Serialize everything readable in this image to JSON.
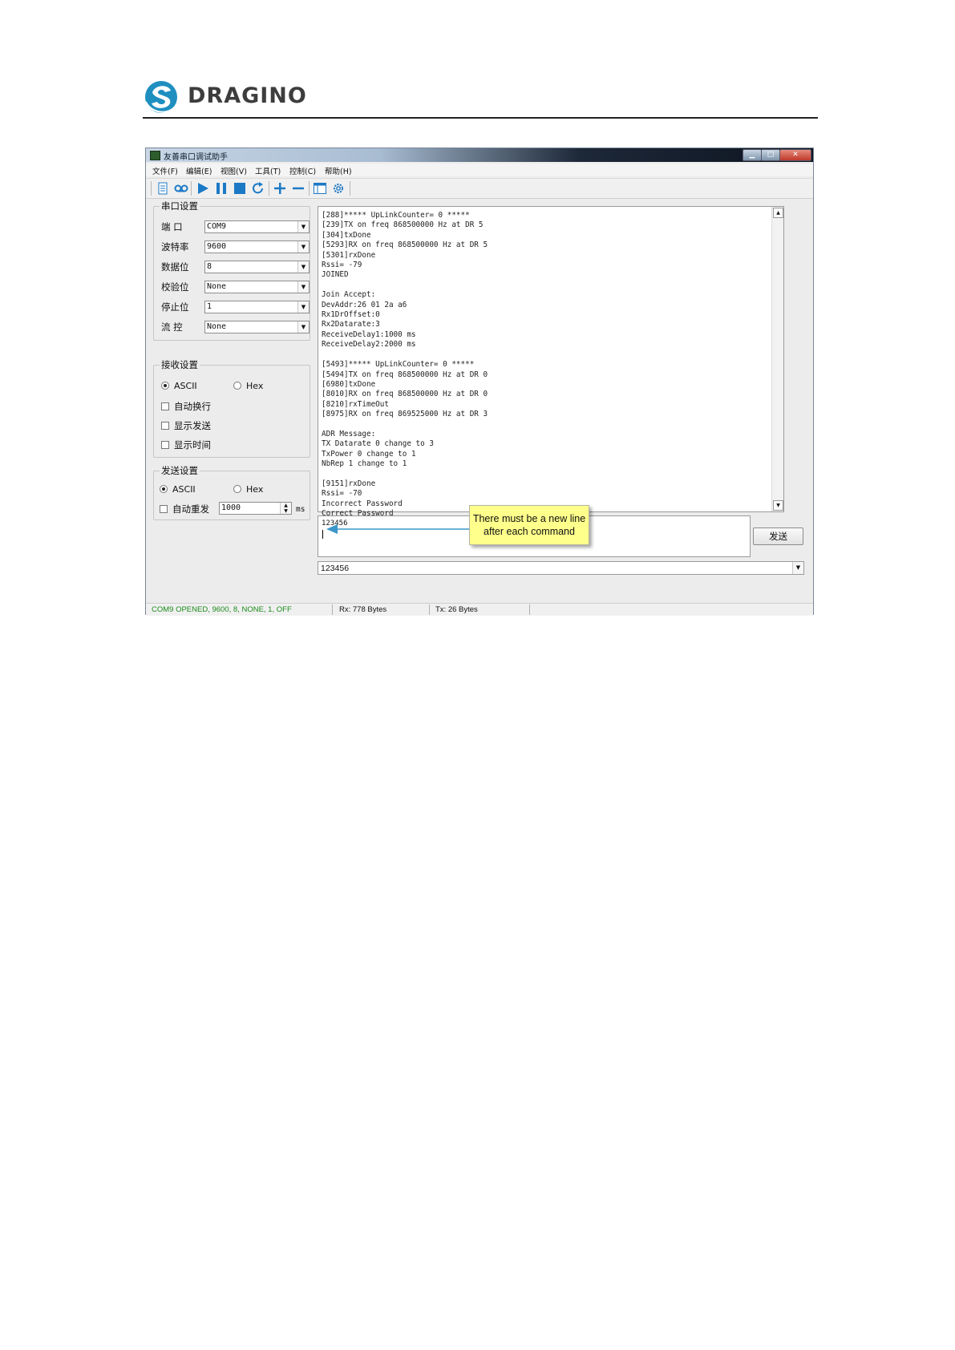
{
  "brand": {
    "name": "DRAGINO",
    "logo_colors": {
      "primary": "#1f8fc0",
      "text": "#3d3d3d"
    }
  },
  "window": {
    "title": "友善串口调试助手",
    "controls": {
      "minimize": "▁",
      "maximize": "□",
      "close": "✕"
    }
  },
  "menu": [
    "文件(F)",
    "编辑(E)",
    "视图(V)",
    "工具(T)",
    "控制(C)",
    "帮助(H)"
  ],
  "toolbar": {
    "icons": [
      "document-icon",
      "record-icon",
      "play-icon",
      "pause-icon",
      "stop-icon",
      "refresh-icon",
      "add-icon",
      "remove-icon",
      "window-icon",
      "settings-icon"
    ],
    "accent": "#1c79c6"
  },
  "serial_settings": {
    "title": "串口设置",
    "port": {
      "label": "端  口",
      "value": "COM9"
    },
    "baud": {
      "label": "波特率",
      "value": "9600"
    },
    "data_bits": {
      "label": "数据位",
      "value": "8"
    },
    "parity": {
      "label": "校验位",
      "value": "None"
    },
    "stop_bits": {
      "label": "停止位",
      "value": "1"
    },
    "flow": {
      "label": "流  控",
      "value": "None"
    }
  },
  "receive_settings": {
    "title": "接收设置",
    "mode_ascii": "ASCII",
    "mode_hex": "Hex",
    "selected": "ASCII",
    "auto_newline": "自动换行",
    "show_send": "显示发送",
    "show_time": "显示时间"
  },
  "send_settings": {
    "title": "发送设置",
    "mode_ascii": "ASCII",
    "mode_hex": "Hex",
    "selected": "ASCII",
    "auto_resend": "自动重发",
    "interval": "1000",
    "unit": "ms"
  },
  "receive_log": [
    "[288]***** UpLinkCounter= 0 *****",
    "[239]TX on freq 868500000 Hz at DR 5",
    "[304]txDone",
    "[5293]RX on freq 868500000 Hz at DR 5",
    "[5301]rxDone",
    "Rssi= -79",
    "JOINED",
    "",
    "Join Accept:",
    "DevAddr:26 01 2a a6",
    "Rx1DrOffset:0",
    "Rx2Datarate:3",
    "ReceiveDelay1:1000 ms",
    "ReceiveDelay2:2000 ms",
    "",
    "[5493]***** UpLinkCounter= 0 *****",
    "[5494]TX on freq 868500000 Hz at DR 0",
    "[6980]txDone",
    "[8010]RX on freq 868500000 Hz at DR 0",
    "[8210]rxTimeOut",
    "[8975]RX on freq 869525000 Hz at DR 3",
    "",
    "ADR Message:",
    "TX Datarate 0 change to 3",
    "TxPower 0 change to 1",
    "NbRep 1 change to 1",
    "",
    "[9151]rxDone",
    "Rssi= -70",
    "Incorrect Password",
    "Correct Password"
  ],
  "send_input": {
    "value": "123456"
  },
  "send_button": "发送",
  "history": {
    "value": "123456"
  },
  "annotation": {
    "line1": "There  must be a new line",
    "line2": "after each command",
    "arrow_color": "#3a97c9",
    "bg": "#ffff8c"
  },
  "status": {
    "port": "COM9 OPENED, 9600, 8, NONE, 1, OFF",
    "rx": "Rx: 778 Bytes",
    "tx": "Tx: 26 Bytes",
    "port_color": "#1a8a1a"
  }
}
